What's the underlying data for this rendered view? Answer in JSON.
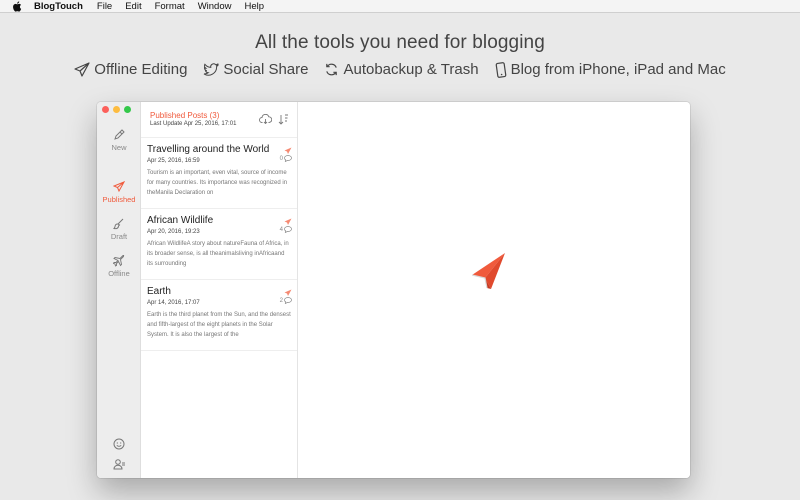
{
  "menubar": {
    "app_name": "BlogTouch",
    "items": [
      "File",
      "Edit",
      "Format",
      "Window",
      "Help"
    ]
  },
  "headline": "All the tools you need for blogging",
  "features": [
    {
      "icon": "paper-plane-icon",
      "label": "Offline Editing"
    },
    {
      "icon": "twitter-bird-icon",
      "label": "Social Share"
    },
    {
      "icon": "refresh-icon",
      "label": "Autobackup & Trash"
    },
    {
      "icon": "phone-icon",
      "label": "Blog from iPhone, iPad and Mac"
    }
  ],
  "sidebar": {
    "items": [
      {
        "icon": "pen-icon",
        "label": "New"
      },
      {
        "icon": "paper-plane-icon",
        "label": "Published",
        "active": true
      },
      {
        "icon": "brush-icon",
        "label": "Draft"
      },
      {
        "icon": "airplane-icon",
        "label": "Offline"
      }
    ]
  },
  "list": {
    "title": "Published Posts (3)",
    "subtitle": "Last Update Apr 25, 2016, 17:01"
  },
  "posts": [
    {
      "title": "Travelling around the World",
      "date": "Apr 25, 2016, 16:59",
      "comments": "0",
      "excerpt": "Tourism is an important, even vital, source of income for many countries. Its importance was recognized in theManila Declaration on"
    },
    {
      "title": "African Wildlife",
      "date": "Apr 20, 2016, 19:23",
      "comments": "4",
      "excerpt": "African WildlifeA story about natureFauna of Africa, in its broader sense, is all theanimalsliving inAfricaand its surrounding"
    },
    {
      "title": "Earth",
      "date": "Apr 14, 2016, 17:07",
      "comments": "2",
      "excerpt": "Earth is the third planet from the Sun, and the densest and fifth-largest of the eight planets in the Solar System. It is also the largest of the"
    }
  ],
  "colors": {
    "accent": "#f05a3c",
    "background": "#e9e9e9"
  }
}
